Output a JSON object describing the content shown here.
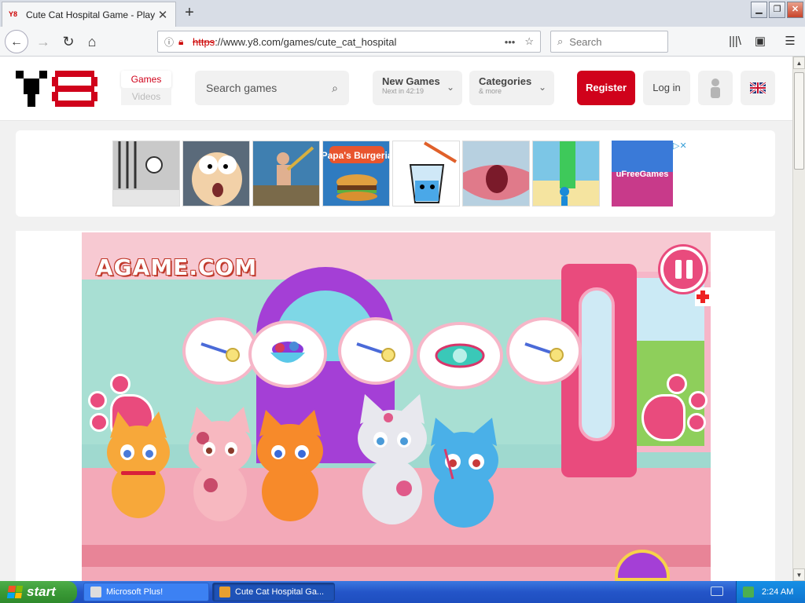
{
  "browser": {
    "tab_title": "Cute Cat Hospital Game - Play onli",
    "tab_favicon": "Y8",
    "new_tab_label": "+",
    "url_scheme": "https",
    "url_rest": "://www.y8.com/games/cute_cat_hospital",
    "search_placeholder": "Search",
    "page_actions": "•••"
  },
  "site": {
    "nav_games": "Games",
    "nav_videos": "Videos",
    "search_placeholder": "Search games",
    "new_games_label": "New Games",
    "new_games_sub": "Next in 42:19",
    "categories_label": "Categories",
    "categories_sub": "& more",
    "register_label": "Register",
    "login_label": "Log in",
    "brand_color": "#d0021b"
  },
  "ads": {
    "thumbs": [
      {
        "name": "stickman-prison-thumb",
        "label": "",
        "color": "#c9c9c9"
      },
      {
        "name": "cartoon-face-thumb",
        "label": "",
        "color": "#5a6a7a"
      },
      {
        "name": "climber-thumb",
        "label": "",
        "color": "#3f7fb0"
      },
      {
        "name": "papas-burgeria-thumb",
        "label": "Papa's Burgeria",
        "color": "#2f7bc0"
      },
      {
        "name": "happy-glass-thumb",
        "label": "",
        "color": "#ffffff"
      },
      {
        "name": "mouth-thumb",
        "label": "",
        "color": "#d87c7c"
      },
      {
        "name": "tower-runner-thumb",
        "label": "",
        "color": "#7cc6e6"
      }
    ],
    "freegames_label": "uFreeGames",
    "adchoices_glyph": "▷✕"
  },
  "game": {
    "brand_watermark": "AGAME.COM"
  },
  "taskbar": {
    "start_label": "start",
    "tasks": [
      {
        "label": "Microsoft Plus!"
      },
      {
        "label": "Cute Cat Hospital Ga..."
      }
    ],
    "clock": "2:24 AM"
  }
}
